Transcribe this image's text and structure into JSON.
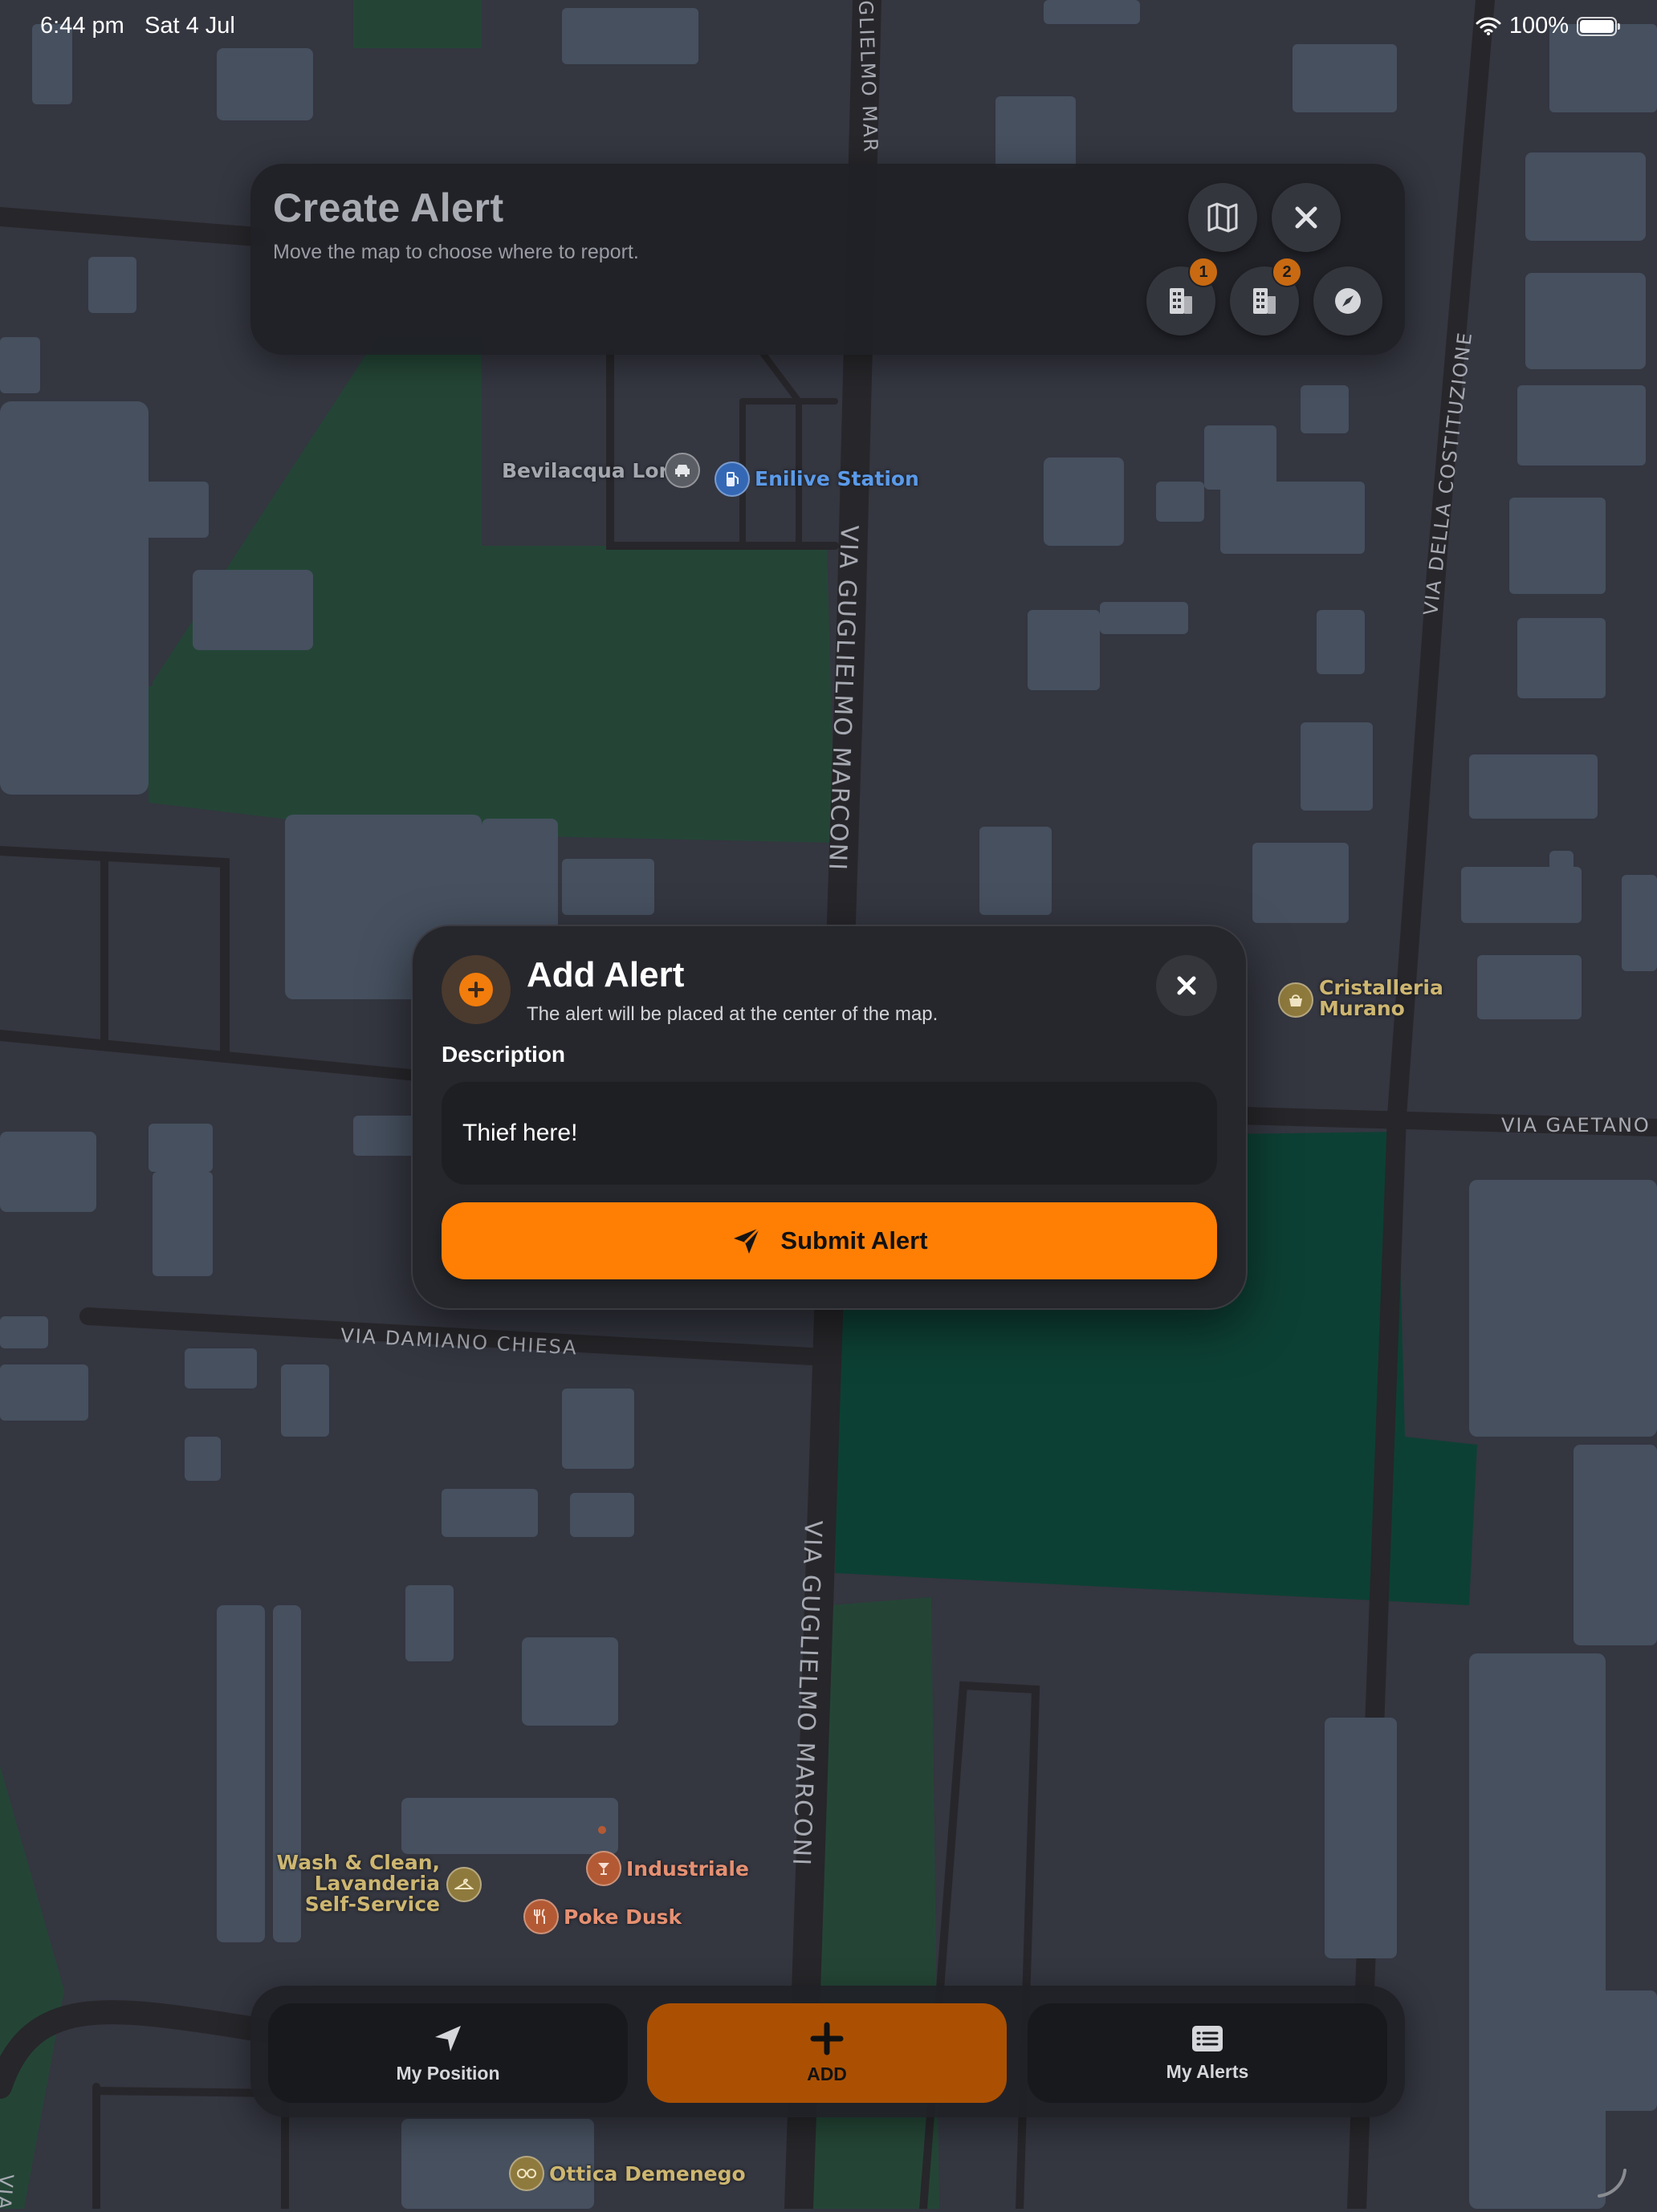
{
  "status_bar": {
    "time": "6:44 pm",
    "date": "Sat 4 Jul",
    "battery": "100%"
  },
  "header": {
    "title": "Create Alert",
    "subtitle": "Move the map to choose where to report.",
    "buttons": [
      {
        "name": "map-layers",
        "icon": "map-icon"
      },
      {
        "name": "close-header",
        "icon": "close-icon"
      },
      {
        "name": "buildings-1",
        "icon": "building-icon",
        "badge": "1"
      },
      {
        "name": "buildings-2",
        "icon": "building-icon",
        "badge": "2"
      },
      {
        "name": "compass",
        "icon": "compass-icon"
      }
    ]
  },
  "map": {
    "streets": {
      "marconi_top": "GLIELMO MAR",
      "marconi_mid": "VIA GUGLIELMO MARCONI",
      "marconi_bottom": "VIA GUGLIELMO MARCONI",
      "costituzione": "VIA DELLA COSTITUZIONE",
      "gaetano": "VIA GAETANO T",
      "damiano": "VIA DAMIANO CHIESA",
      "edge_left": "VIA"
    },
    "pois": {
      "bevilacqua": "Bevilacqua Loris",
      "enilive": "Enilive Station",
      "cristalleria_1": "Cristalleria",
      "cristalleria_2": "Murano",
      "wash_1": "Wash & Clean,",
      "wash_2": "Lavanderia",
      "wash_3": "Self-Service",
      "industriale": "Industriale",
      "poke": "Poke Dusk",
      "ottica": "Ottica Demenego"
    }
  },
  "modal": {
    "title": "Add Alert",
    "subtitle": "The alert will be placed at the center of the map.",
    "description_label": "Description",
    "description_value": "Thief here!",
    "submit_label": "Submit Alert"
  },
  "bottom_nav": {
    "my_position": "My Position",
    "add": "ADD",
    "my_alerts": "My Alerts"
  },
  "colors": {
    "accent": "#ff7f05",
    "accent_dark": "#ab5002",
    "map_bg": "#343640",
    "building": "#46505f",
    "park": "#1f4a39",
    "road": "#27262a"
  }
}
